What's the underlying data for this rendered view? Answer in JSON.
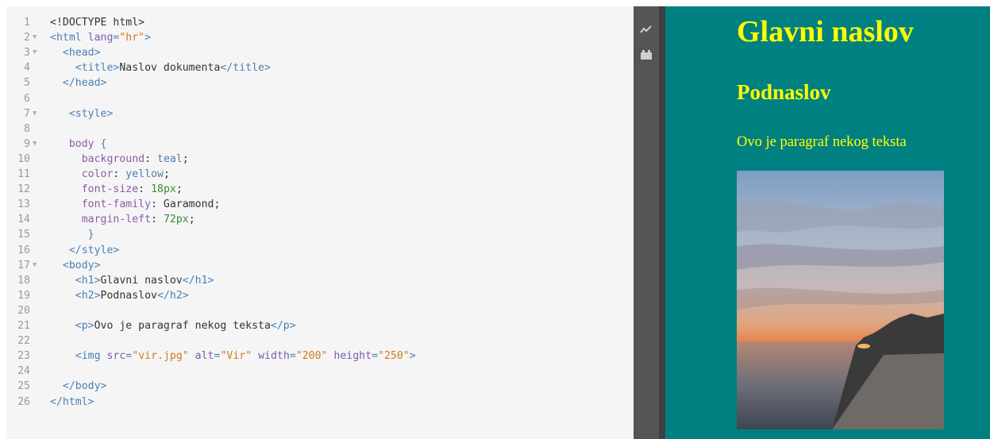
{
  "editor": {
    "lines": [
      {
        "n": "1",
        "fold": "",
        "segs": [
          [
            "txt",
            "<!DOCTYPE html>"
          ]
        ]
      },
      {
        "n": "2",
        "fold": "▼",
        "segs": [
          [
            "tag",
            "<html "
          ],
          [
            "attr",
            "lang"
          ],
          [
            "tag",
            "="
          ],
          [
            "str",
            "\"hr\""
          ],
          [
            "tag",
            ">"
          ]
        ]
      },
      {
        "n": "3",
        "fold": "▼",
        "segs": [
          [
            "txt",
            "  "
          ],
          [
            "tag",
            "<head>"
          ]
        ]
      },
      {
        "n": "4",
        "fold": "",
        "segs": [
          [
            "txt",
            "    "
          ],
          [
            "tag",
            "<title>"
          ],
          [
            "txt",
            "Naslov dokumenta"
          ],
          [
            "tag",
            "</title>"
          ]
        ]
      },
      {
        "n": "5",
        "fold": "",
        "segs": [
          [
            "txt",
            "  "
          ],
          [
            "tag",
            "</head>"
          ]
        ]
      },
      {
        "n": "6",
        "fold": "",
        "segs": []
      },
      {
        "n": "7",
        "fold": "▼",
        "segs": [
          [
            "txt",
            "   "
          ],
          [
            "tag",
            "<style>"
          ]
        ]
      },
      {
        "n": "8",
        "fold": "",
        "segs": []
      },
      {
        "n": "9",
        "fold": "▼",
        "segs": [
          [
            "txt",
            "   "
          ],
          [
            "prop",
            "body"
          ],
          [
            "txt",
            " "
          ],
          [
            "tag",
            "{"
          ]
        ]
      },
      {
        "n": "10",
        "fold": "",
        "segs": [
          [
            "txt",
            "     "
          ],
          [
            "prop",
            "background"
          ],
          [
            "txt",
            ": "
          ],
          [
            "val",
            "teal"
          ],
          [
            "txt",
            ";"
          ]
        ]
      },
      {
        "n": "11",
        "fold": "",
        "segs": [
          [
            "txt",
            "     "
          ],
          [
            "prop",
            "color"
          ],
          [
            "txt",
            ": "
          ],
          [
            "val",
            "yellow"
          ],
          [
            "txt",
            ";"
          ]
        ]
      },
      {
        "n": "12",
        "fold": "",
        "segs": [
          [
            "txt",
            "     "
          ],
          [
            "prop",
            "font-size"
          ],
          [
            "txt",
            ": "
          ],
          [
            "num",
            "18px"
          ],
          [
            "txt",
            ";"
          ]
        ]
      },
      {
        "n": "13",
        "fold": "",
        "segs": [
          [
            "txt",
            "     "
          ],
          [
            "prop",
            "font-family"
          ],
          [
            "txt",
            ": Garamond;"
          ]
        ]
      },
      {
        "n": "14",
        "fold": "",
        "segs": [
          [
            "txt",
            "     "
          ],
          [
            "prop",
            "margin-left"
          ],
          [
            "txt",
            ": "
          ],
          [
            "num",
            "72px"
          ],
          [
            "txt",
            ";"
          ]
        ]
      },
      {
        "n": "15",
        "fold": "",
        "segs": [
          [
            "txt",
            "      "
          ],
          [
            "tag",
            "}"
          ]
        ]
      },
      {
        "n": "16",
        "fold": "",
        "segs": [
          [
            "txt",
            "   "
          ],
          [
            "tag",
            "</style>"
          ]
        ]
      },
      {
        "n": "17",
        "fold": "▼",
        "segs": [
          [
            "txt",
            "  "
          ],
          [
            "tag",
            "<body>"
          ]
        ]
      },
      {
        "n": "18",
        "fold": "",
        "segs": [
          [
            "txt",
            "    "
          ],
          [
            "tag",
            "<h1>"
          ],
          [
            "txt",
            "Glavni naslov"
          ],
          [
            "tag",
            "</h1>"
          ]
        ]
      },
      {
        "n": "19",
        "fold": "",
        "segs": [
          [
            "txt",
            "    "
          ],
          [
            "tag",
            "<h2>"
          ],
          [
            "txt",
            "Podnaslov"
          ],
          [
            "tag",
            "</h2>"
          ]
        ]
      },
      {
        "n": "20",
        "fold": "",
        "segs": []
      },
      {
        "n": "21",
        "fold": "",
        "segs": [
          [
            "txt",
            "    "
          ],
          [
            "tag",
            "<p>"
          ],
          [
            "txt",
            "Ovo je paragraf nekog teksta"
          ],
          [
            "tag",
            "</p>"
          ]
        ]
      },
      {
        "n": "22",
        "fold": "",
        "segs": []
      },
      {
        "n": "23",
        "fold": "",
        "segs": [
          [
            "txt",
            "    "
          ],
          [
            "tag",
            "<img "
          ],
          [
            "attr",
            "src"
          ],
          [
            "tag",
            "="
          ],
          [
            "str",
            "\"vir.jpg\""
          ],
          [
            "txt",
            " "
          ],
          [
            "attr",
            "alt"
          ],
          [
            "tag",
            "="
          ],
          [
            "str",
            "\"Vir\""
          ],
          [
            "txt",
            " "
          ],
          [
            "attr",
            "width"
          ],
          [
            "tag",
            "="
          ],
          [
            "str",
            "\"200\""
          ],
          [
            "txt",
            " "
          ],
          [
            "attr",
            "height"
          ],
          [
            "tag",
            "="
          ],
          [
            "str",
            "\"250\""
          ],
          [
            "tag",
            ">"
          ]
        ]
      },
      {
        "n": "24",
        "fold": "",
        "segs": []
      },
      {
        "n": "25",
        "fold": "",
        "segs": [
          [
            "txt",
            "  "
          ],
          [
            "tag",
            "</body>"
          ]
        ]
      },
      {
        "n": "26",
        "fold": "",
        "segs": [
          [
            "tag",
            "</html>"
          ]
        ]
      }
    ]
  },
  "sidebar": {
    "icons": [
      "activity-graph-icon",
      "plugin-block-icon"
    ]
  },
  "preview": {
    "background": "#008080",
    "text_color": "#ffff00",
    "h1": "Glavni naslov",
    "h2": "Podnaslov",
    "paragraph": "Ovo je paragraf nekog teksta",
    "image_alt": "Vir"
  }
}
